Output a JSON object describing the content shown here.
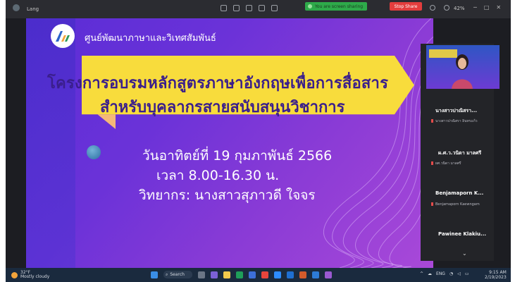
{
  "window": {
    "title": "Lang"
  },
  "share_bar": {
    "label": "You are screen sharing",
    "stop_label": "Stop Share",
    "zoom_level": "42%"
  },
  "slide": {
    "center_name": "ศูนย์พัฒนาภาษาและวิเทศสัมพันธ์",
    "title_line1": "โครงการอบรมหลักสูตรภาษาอังกฤษเพื่อการสื่อสาร",
    "title_line2": "สำหรับบุคลากรสายสนับสนุนวิชาการ",
    "date_line": "วันอาทิตย์ที่ 19 กุมภาพันธ์ 2566",
    "time_line": "เวลา 8.00-16.30 น.",
    "speaker_line": "วิทยากร: นางสาวสุภาวดี   ใจจร",
    "colors": {
      "banner": "#f8dc3c",
      "title_text": "#3a1e8c",
      "background_start": "#5a2dd6",
      "background_end": "#a949d8"
    }
  },
  "participants": [
    {
      "name": "นางสาวปาณิสรา...",
      "sub": "นางสาวปาณิสรา อินทรแก้ว"
    },
    {
      "name": "ผ.ศ.ว.วนิดา มาลศรี",
      "sub": "ผศ.วนิดา มาลศรี"
    },
    {
      "name": "Benjamaporn K...",
      "sub": "Benjamaporn Kaewngam"
    },
    {
      "name": "Pawinee Klakiu...",
      "sub": ""
    }
  ],
  "taskbar": {
    "weather_temp": "32°F",
    "weather_text": "Mostly cloudy",
    "search_label": "Search",
    "lang": "ENG",
    "time": "9:15 AM",
    "date": "2/19/2023"
  }
}
